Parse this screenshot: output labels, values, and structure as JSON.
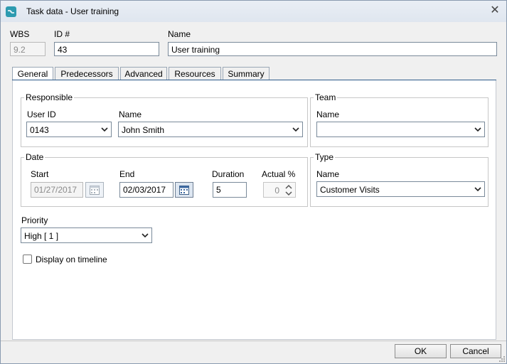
{
  "window": {
    "title": "Task data - User training"
  },
  "header": {
    "wbs": {
      "label": "WBS",
      "value": "9.2"
    },
    "id": {
      "label": "ID #",
      "value": "43"
    },
    "name": {
      "label": "Name",
      "value": "User training"
    }
  },
  "tabs": [
    {
      "label": "General",
      "active": true
    },
    {
      "label": "Predecessors"
    },
    {
      "label": "Advanced"
    },
    {
      "label": "Resources"
    },
    {
      "label": "Summary"
    }
  ],
  "general": {
    "responsible": {
      "title": "Responsible",
      "user_id_label": "User ID",
      "user_id_value": "0143",
      "name_label": "Name",
      "name_value": "John Smith"
    },
    "team": {
      "title": "Team",
      "name_label": "Name",
      "name_value": ""
    },
    "date": {
      "title": "Date",
      "start_label": "Start",
      "start_value": "01/27/2017",
      "end_label": "End",
      "end_value": "02/03/2017",
      "duration_label": "Duration",
      "duration_value": "5",
      "actual_label": "Actual %",
      "actual_value": "0"
    },
    "type": {
      "title": "Type",
      "name_label": "Name",
      "name_value": "Customer Visits"
    },
    "priority": {
      "label": "Priority",
      "value": "High [ 1 ]"
    },
    "timeline": {
      "label": "Display on timeline",
      "checked": false
    }
  },
  "buttons": {
    "ok": "OK",
    "cancel": "Cancel"
  },
  "colors": {
    "tab_accent": "#2d5a8a",
    "app_icon": "#2d9bb0"
  }
}
